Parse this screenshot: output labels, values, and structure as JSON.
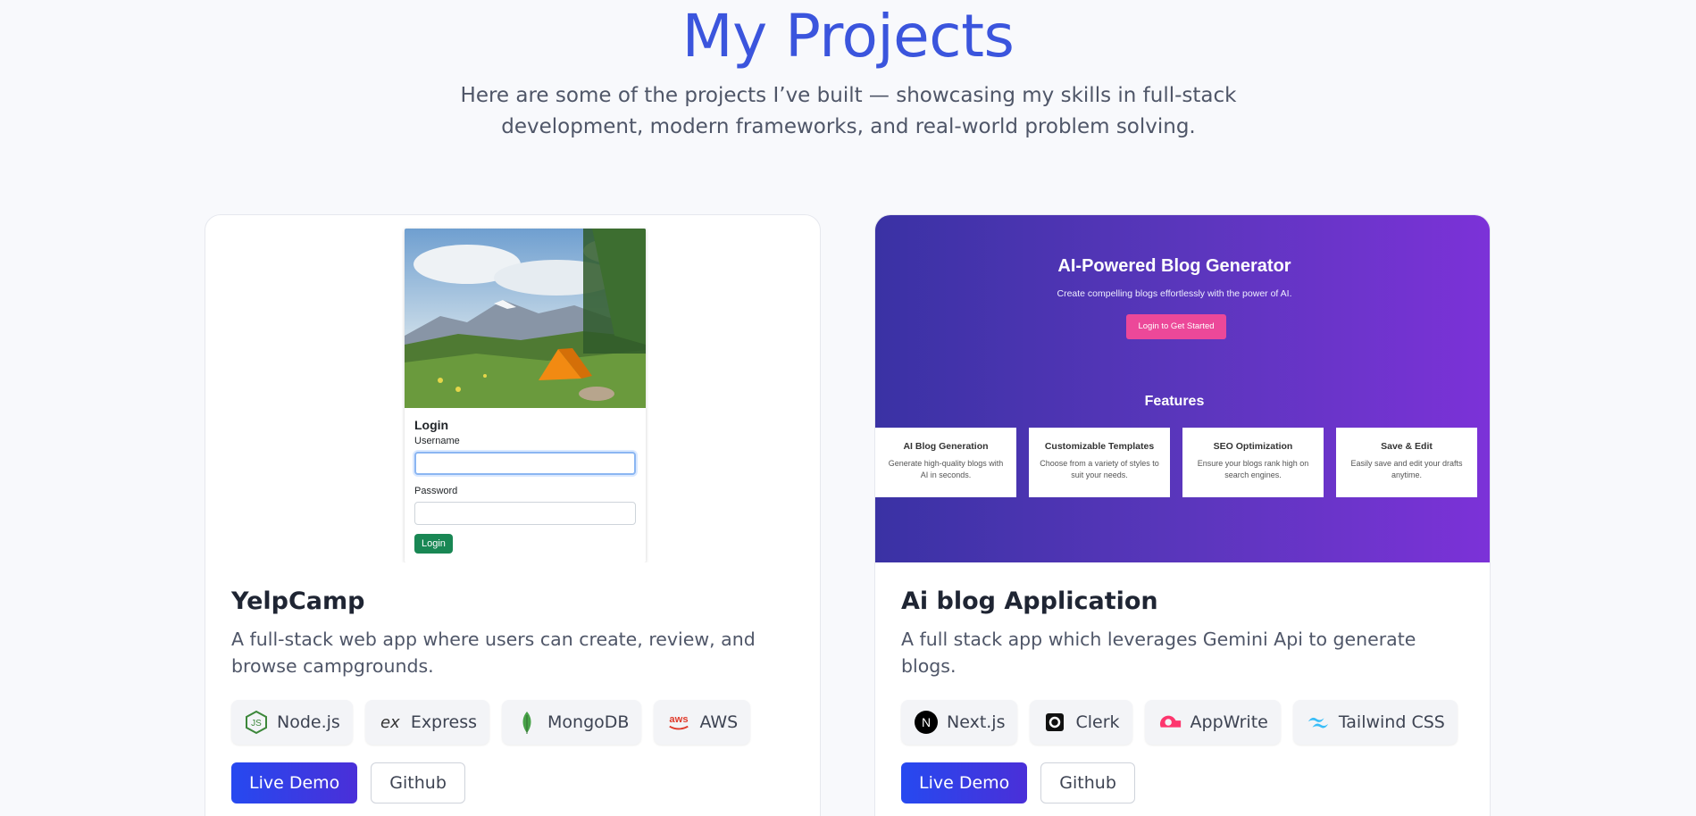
{
  "header": {
    "title": "My Projects",
    "subtitle": "Here are some of the projects I’ve built — showcasing my skills in full-stack development, modern frameworks, and real-world problem solving."
  },
  "projects": [
    {
      "title": "YelpCamp",
      "description": "A full-stack web app where users can create, review, and browse campgrounds.",
      "preview": {
        "heading": "Login",
        "username_label": "Username",
        "password_label": "Password",
        "button": "Login"
      },
      "tags": [
        {
          "label": "Node.js",
          "icon": "nodejs-icon"
        },
        {
          "label": "Express",
          "icon": "express-icon"
        },
        {
          "label": "MongoDB",
          "icon": "mongodb-icon"
        },
        {
          "label": "AWS",
          "icon": "aws-icon"
        }
      ],
      "live_label": "Live Demo",
      "github_label": "Github"
    },
    {
      "title": "Ai blog Application",
      "description": "A full stack app which leverages Gemini Api to generate blogs.",
      "preview": {
        "heading": "AI-Powered Blog Generator",
        "subheading": "Create compelling blogs effortlessly with the power of AI.",
        "cta": "Login to Get Started",
        "features_title": "Features",
        "features": [
          {
            "title": "AI Blog Generation",
            "desc": "Generate high-quality blogs with AI in seconds."
          },
          {
            "title": "Customizable Templates",
            "desc": "Choose from a variety of styles to suit your needs."
          },
          {
            "title": "SEO Optimization",
            "desc": "Ensure your blogs rank high on search engines."
          },
          {
            "title": "Save & Edit",
            "desc": "Easily save and edit your drafts anytime."
          }
        ]
      },
      "tags": [
        {
          "label": "Next.js",
          "icon": "nextjs-icon"
        },
        {
          "label": "Clerk",
          "icon": "clerk-icon"
        },
        {
          "label": "AppWrite",
          "icon": "appwrite-icon"
        },
        {
          "label": "Tailwind CSS",
          "icon": "tailwind-icon"
        }
      ],
      "live_label": "Live Demo",
      "github_label": "Github"
    }
  ],
  "colors": {
    "accent": "#3b55dd",
    "live_button": "#2649f0",
    "blog_gradient_start": "#3a32a4",
    "blog_gradient_end": "#7c32d8"
  }
}
